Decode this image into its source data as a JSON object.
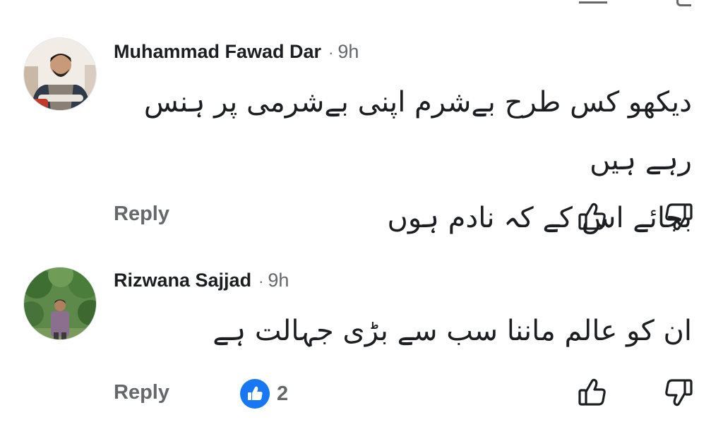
{
  "comments": [
    {
      "author": "Muhammad Fawad Dar",
      "separator": "·",
      "time": "9h",
      "text_lines": [
        "دیکھو کس طرح بےشرم اپنی بےشرمی پر ہنس رہے ہیں",
        "بجائے اس کے کہ نادم ہوں"
      ],
      "reply_label": "Reply"
    },
    {
      "author": "Rizwana Sajjad",
      "separator": "·",
      "time": "9h",
      "text_lines": [
        "ان کو عالم ماننا سب سے بڑی جہالت ہے"
      ],
      "reply_label": "Reply",
      "reaction_count": "2"
    }
  ],
  "icons": {
    "like": "thumbs-up-icon",
    "dislike": "thumbs-down-icon",
    "reaction": "like-reaction-icon"
  },
  "colors": {
    "text": "#1c1e21",
    "muted": "#65676b",
    "like_badge": "#1877f2"
  }
}
